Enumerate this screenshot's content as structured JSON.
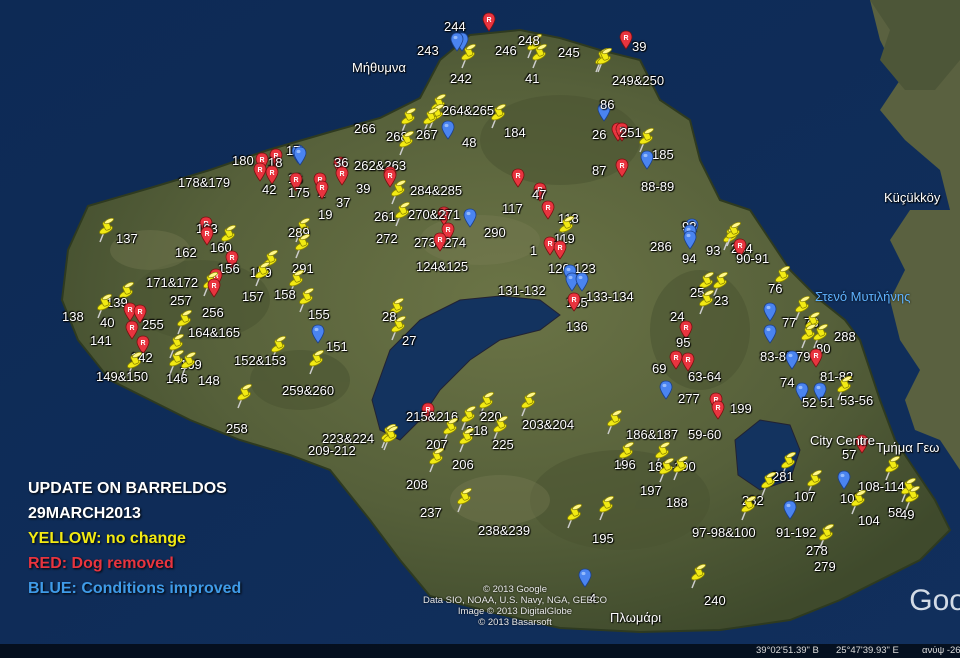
{
  "legend": {
    "title": "UPDATE ON BARRELDOS",
    "date": "29MARCH2013",
    "yellow": "YELLOW: no change",
    "red": "RED: Dog removed",
    "blue": "BLUE: Conditions improved"
  },
  "colors": {
    "yellow": "#f2ea13",
    "red": "#e8343f",
    "blue": "#4a84f0",
    "land": "#58623a",
    "sea": "#0f2d58"
  },
  "places": [
    {
      "name": "Μήθυμνα"
    },
    {
      "name": "Küçükköy"
    },
    {
      "name": "Στενό Μυτιλήνης"
    },
    {
      "name": "City Centre"
    },
    {
      "name": "Τμήμα Γεω"
    },
    {
      "name": "Πλωμάρι"
    }
  ],
  "pins": [
    {
      "label": "244",
      "color": "blue"
    },
    {
      "label": "243",
      "color": "blue"
    },
    {
      "label": "242",
      "color": "yellow"
    },
    {
      "label": "246",
      "color": "red"
    },
    {
      "label": "248",
      "color": "yellow"
    },
    {
      "label": "41",
      "color": "yellow"
    },
    {
      "label": "245",
      "color": "yellow"
    },
    {
      "label": "39",
      "color": "red"
    },
    {
      "label": "249&250",
      "color": "yellow"
    },
    {
      "label": "86",
      "color": "blue"
    },
    {
      "label": "26",
      "color": "red"
    },
    {
      "label": "251",
      "color": "red"
    },
    {
      "label": "185",
      "color": "yellow"
    },
    {
      "label": "87",
      "color": "red"
    },
    {
      "label": "88-89",
      "color": "blue"
    },
    {
      "label": "264&265",
      "color": "yellow"
    },
    {
      "label": "184",
      "color": "yellow"
    },
    {
      "label": "266",
      "color": "yellow"
    },
    {
      "label": "268",
      "color": "yellow"
    },
    {
      "label": "267",
      "color": "yellow"
    },
    {
      "label": "48",
      "color": "blue"
    },
    {
      "label": "17",
      "color": "blue"
    },
    {
      "label": "180",
      "color": "red"
    },
    {
      "label": "18",
      "color": "red"
    },
    {
      "label": "16",
      "color": "blue"
    },
    {
      "label": "36",
      "color": "red"
    },
    {
      "label": "262&263",
      "color": "yellow"
    },
    {
      "label": "178&179",
      "color": "red"
    },
    {
      "label": "42",
      "color": "red"
    },
    {
      "label": "175",
      "color": "red"
    },
    {
      "label": "2",
      "color": "red"
    },
    {
      "label": "37",
      "color": "red"
    },
    {
      "label": "39",
      "color": "red"
    },
    {
      "label": "284&285",
      "color": "red"
    },
    {
      "label": "19",
      "color": "red"
    },
    {
      "label": "117",
      "color": "red"
    },
    {
      "label": "47",
      "color": "red"
    },
    {
      "label": "261",
      "color": "yellow"
    },
    {
      "label": "270&271",
      "color": "red"
    },
    {
      "label": "118",
      "color": "red"
    },
    {
      "label": "272",
      "color": "yellow"
    },
    {
      "label": "290",
      "color": "blue"
    },
    {
      "label": "273&274",
      "color": "red"
    },
    {
      "label": "1",
      "color": "red"
    },
    {
      "label": "119",
      "color": "yellow"
    },
    {
      "label": "124&125",
      "color": "red"
    },
    {
      "label": "120-123",
      "color": "red"
    },
    {
      "label": "92",
      "color": "blue"
    },
    {
      "label": "286",
      "color": "blue"
    },
    {
      "label": "94",
      "color": "blue"
    },
    {
      "label": "93",
      "color": "yellow"
    },
    {
      "label": "254",
      "color": "yellow"
    },
    {
      "label": "90-91",
      "color": "red"
    },
    {
      "label": "137",
      "color": "yellow"
    },
    {
      "label": "163",
      "color": "red"
    },
    {
      "label": "162",
      "color": "red"
    },
    {
      "label": "160",
      "color": "yellow"
    },
    {
      "label": "289",
      "color": "yellow"
    },
    {
      "label": "291",
      "color": "yellow"
    },
    {
      "label": "156",
      "color": "red"
    },
    {
      "label": "159",
      "color": "yellow"
    },
    {
      "label": "171&172",
      "color": "red"
    },
    {
      "label": "157",
      "color": "yellow"
    },
    {
      "label": "158",
      "color": "yellow"
    },
    {
      "label": "257",
      "color": "yellow"
    },
    {
      "label": "256",
      "color": "red"
    },
    {
      "label": "131-132",
      "color": "blue"
    },
    {
      "label": "135",
      "color": "blue"
    },
    {
      "label": "133-134",
      "color": "blue"
    },
    {
      "label": "136",
      "color": "red"
    },
    {
      "label": "25",
      "color": "yellow"
    },
    {
      "label": "23",
      "color": "yellow"
    },
    {
      "label": "76",
      "color": "yellow"
    },
    {
      "label": "24",
      "color": "yellow"
    },
    {
      "label": "139",
      "color": "yellow"
    },
    {
      "label": "138",
      "color": "yellow"
    },
    {
      "label": "40",
      "color": "red"
    },
    {
      "label": "255",
      "color": "red"
    },
    {
      "label": "155",
      "color": "yellow"
    },
    {
      "label": "28",
      "color": "yellow"
    },
    {
      "label": "141",
      "color": "red"
    },
    {
      "label": "164&165",
      "color": "yellow"
    },
    {
      "label": "27",
      "color": "yellow"
    },
    {
      "label": "77",
      "color": "blue"
    },
    {
      "label": "78",
      "color": "yellow"
    },
    {
      "label": "288",
      "color": "yellow"
    },
    {
      "label": "142",
      "color": "red"
    },
    {
      "label": "151",
      "color": "blue"
    },
    {
      "label": "95",
      "color": "red"
    },
    {
      "label": "83-85",
      "color": "blue"
    },
    {
      "label": "79",
      "color": "yellow"
    },
    {
      "label": "80",
      "color": "yellow"
    },
    {
      "label": "169",
      "color": "yellow"
    },
    {
      "label": "152&153",
      "color": "yellow"
    },
    {
      "label": "149&150",
      "color": "yellow"
    },
    {
      "label": "146",
      "color": "yellow"
    },
    {
      "label": "148",
      "color": "yellow"
    },
    {
      "label": "259&260",
      "color": "yellow"
    },
    {
      "label": "69",
      "color": "red"
    },
    {
      "label": "63-64",
      "color": "red"
    },
    {
      "label": "74",
      "color": "blue"
    },
    {
      "label": "81-82",
      "color": "red"
    },
    {
      "label": "277",
      "color": "blue"
    },
    {
      "label": "199",
      "color": "red"
    },
    {
      "label": "52",
      "color": "blue"
    },
    {
      "label": "51",
      "color": "blue"
    },
    {
      "label": "53-56",
      "color": "yellow"
    },
    {
      "label": "258",
      "color": "yellow"
    },
    {
      "label": "215&216",
      "color": "red"
    },
    {
      "label": "220",
      "color": "yellow"
    },
    {
      "label": "203&204",
      "color": "yellow"
    },
    {
      "label": "223&224",
      "color": "yellow"
    },
    {
      "label": "218",
      "color": "yellow"
    },
    {
      "label": "186&187",
      "color": "yellow"
    },
    {
      "label": "59-60",
      "color": "red"
    },
    {
      "label": "209-212",
      "color": "yellow"
    },
    {
      "label": "207",
      "color": "yellow"
    },
    {
      "label": "225",
      "color": "yellow"
    },
    {
      "label": "206",
      "color": "yellow"
    },
    {
      "label": "57",
      "color": "red"
    },
    {
      "label": "196",
      "color": "yellow"
    },
    {
      "label": "189-190",
      "color": "yellow"
    },
    {
      "label": "208",
      "color": "yellow"
    },
    {
      "label": "197",
      "color": "yellow"
    },
    {
      "label": "188",
      "color": "yellow"
    },
    {
      "label": "281",
      "color": "yellow"
    },
    {
      "label": "108-114",
      "color": "yellow"
    },
    {
      "label": "107",
      "color": "yellow"
    },
    {
      "label": "105",
      "color": "blue"
    },
    {
      "label": "282",
      "color": "yellow"
    },
    {
      "label": "237",
      "color": "yellow"
    },
    {
      "label": "238&239",
      "color": "yellow"
    },
    {
      "label": "97-98&100",
      "color": "yellow"
    },
    {
      "label": "91-192",
      "color": "blue"
    },
    {
      "label": "104",
      "color": "yellow"
    },
    {
      "label": "58",
      "color": "yellow"
    },
    {
      "label": "49",
      "color": "yellow"
    },
    {
      "label": "195",
      "color": "yellow"
    },
    {
      "label": "278",
      "color": "yellow"
    },
    {
      "label": "279",
      "color": "yellow"
    },
    {
      "label": "4",
      "color": "blue"
    },
    {
      "label": "240",
      "color": "yellow"
    }
  ],
  "credits": [
    "© 2013 Google",
    "Data SIO, NOAA, U.S. Navy, NGA, GEBCO",
    "Image © 2013 DigitalGlobe",
    "© 2013 Basarsoft"
  ],
  "brand": "Goo",
  "coords": {
    "lat": "39°02'51.39\" Β",
    "lon": "25°47'39.93\" Ε",
    "alt": "ανύψ -26"
  }
}
